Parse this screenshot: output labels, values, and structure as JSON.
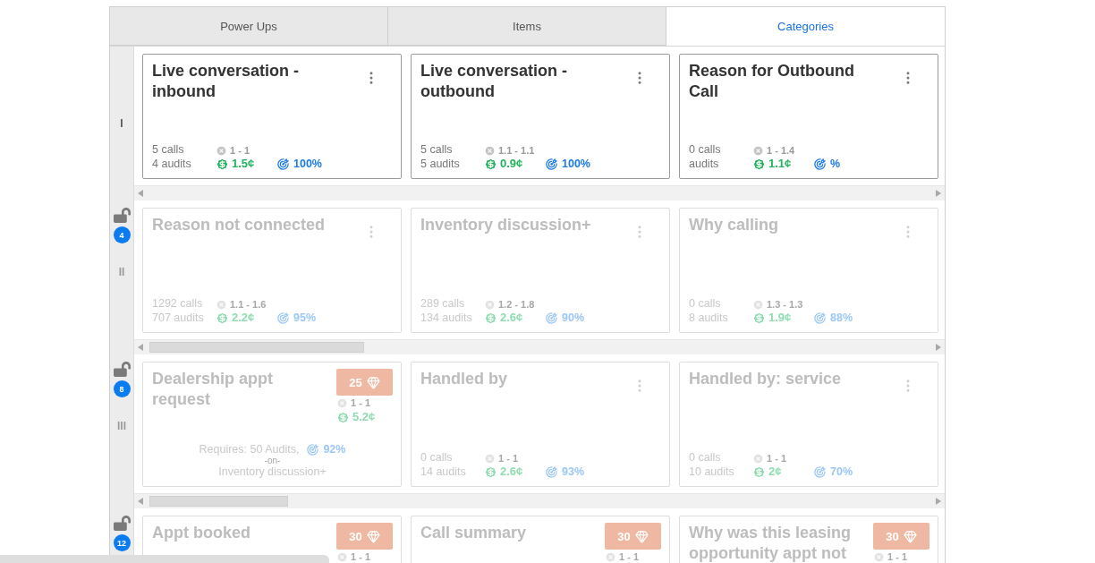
{
  "tabs": [
    {
      "label": "Power Ups",
      "selected": false
    },
    {
      "label": "Items",
      "selected": false
    },
    {
      "label": "Categories",
      "selected": true
    }
  ],
  "levels": [
    {
      "numeral": "I",
      "locked": false,
      "cards": [
        {
          "kind": "stats",
          "title": "Live conversation - inbound",
          "calls": "5 calls",
          "audits": "4 audits",
          "range": "1 - 1",
          "cost": "1.5¢",
          "accuracy": "100%"
        },
        {
          "kind": "stats",
          "title": "Live conversation - outbound",
          "calls": "5 calls",
          "audits": "5 audits",
          "range": "1.1 - 1.1",
          "cost": "0.9¢",
          "accuracy": "100%"
        },
        {
          "kind": "stats",
          "title": "Reason for Outbound Call",
          "calls": "0 calls",
          "audits": "audits",
          "range": "1 - 1.4",
          "cost": "1.1¢",
          "accuracy": "%"
        }
      ]
    },
    {
      "numeral": "II",
      "locked": true,
      "unlock_count": "4",
      "cards": [
        {
          "kind": "stats",
          "title": "Reason not connected",
          "calls": "1292 calls",
          "audits": "707 audits",
          "range": "1.1 - 1.6",
          "cost": "2.2¢",
          "accuracy": "95%"
        },
        {
          "kind": "stats",
          "title": "Inventory discussion+",
          "calls": "289 calls",
          "audits": "134 audits",
          "range": "1.2 - 1.8",
          "cost": "2.6¢",
          "accuracy": "90%"
        },
        {
          "kind": "stats",
          "title": "Why calling",
          "calls": "0 calls",
          "audits": "8 audits",
          "range": "1.3 - 1.3",
          "cost": "1.9¢",
          "accuracy": "88%"
        }
      ]
    },
    {
      "numeral": "III",
      "locked": true,
      "unlock_count": "8",
      "cards": [
        {
          "kind": "purchase",
          "title": "Dealership appt request",
          "price": "25",
          "range": "1 - 1",
          "cost": "5.2¢",
          "requirement": "Requires: 50 Audits,",
          "accuracy": "92%",
          "joiner": "-on-",
          "prerequisite": "Inventory discussion+"
        },
        {
          "kind": "stats",
          "title": "Handled by",
          "calls": "0 calls",
          "audits": "14 audits",
          "range": "1 - 1",
          "cost": "2.6¢",
          "accuracy": "93%"
        },
        {
          "kind": "stats",
          "title": "Handled by: service",
          "calls": "0 calls",
          "audits": "10 audits",
          "range": "1 - 1",
          "cost": "2¢",
          "accuracy": "70%"
        }
      ]
    },
    {
      "locked": true,
      "unlock_count": "12",
      "cards": [
        {
          "kind": "purchase",
          "title": "Appt booked",
          "price": "30",
          "range": "1 - 1"
        },
        {
          "kind": "purchase",
          "title": "Call summary",
          "price": "30",
          "range": "1 - 1"
        },
        {
          "kind": "purchase",
          "title": "Why was this leasing opportunity appt not",
          "price": "30",
          "range": "1 - 1"
        }
      ]
    }
  ]
}
